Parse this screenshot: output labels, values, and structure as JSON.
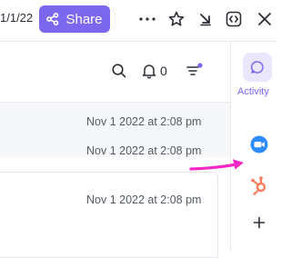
{
  "toolbar": {
    "date_fragment": "1/1/22",
    "share_label": "Share",
    "more_icon": "more-horizontal-icon",
    "star_icon": "star-icon",
    "minimize_icon": "arrow-down-right-icon",
    "embed_icon": "code-embed-icon",
    "close_icon": "close-icon"
  },
  "activity_header": {
    "search_icon": "search-icon",
    "bell_icon": "bell-icon",
    "notification_count": "0",
    "filter_icon": "filter-icon"
  },
  "activity_items": [
    {
      "timestamp": "Nov 1 2022 at 2:08 pm"
    },
    {
      "timestamp": "Nov 1 2022 at 2:08 pm"
    },
    {
      "timestamp": "Nov 1 2022 at 2:08 pm"
    }
  ],
  "sidebar": {
    "activity_label": "Activity",
    "apps": [
      {
        "name": "zoom-app-icon"
      },
      {
        "name": "hubspot-app-icon"
      }
    ],
    "add_icon": "plus-icon"
  },
  "colors": {
    "accent": "#7b68ee",
    "zoom": "#2d8cff",
    "hubspot": "#ff7a59",
    "annotation_arrow": "#f527c8"
  }
}
